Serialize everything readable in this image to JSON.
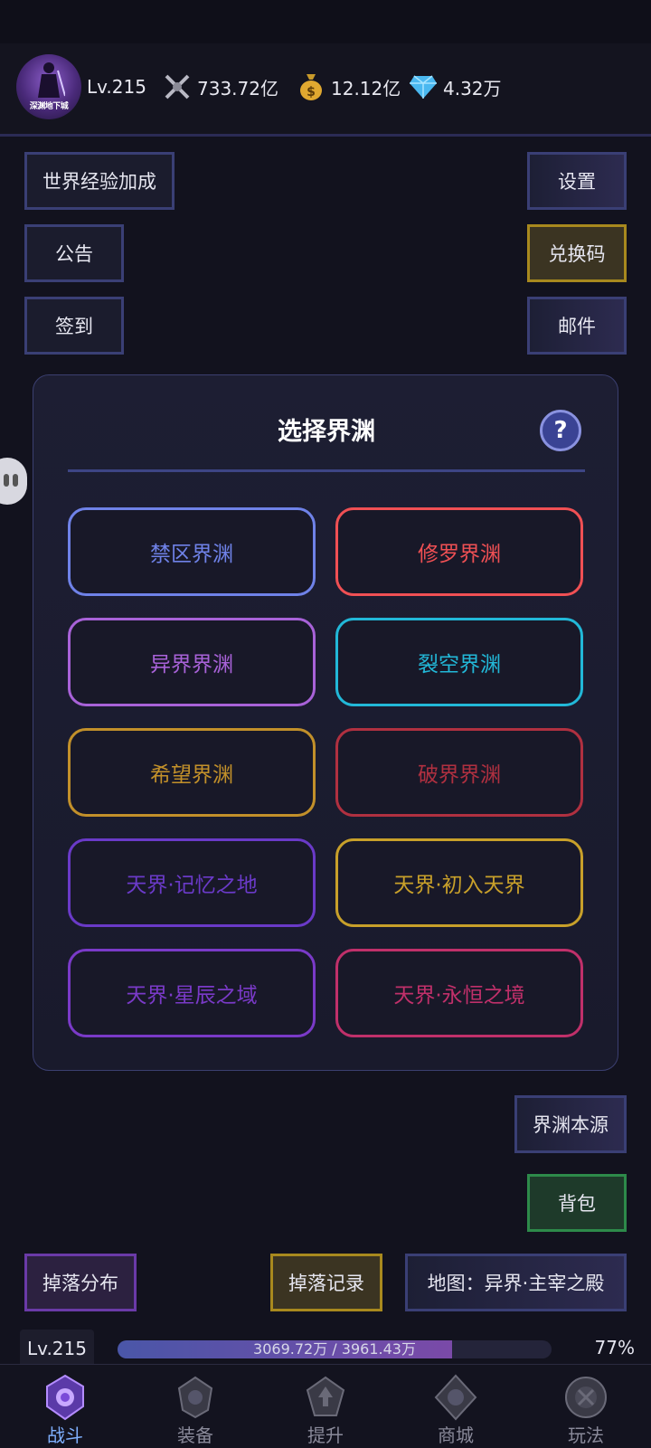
{
  "header": {
    "level": "Lv.215",
    "avatar_logo": "深渊地下城",
    "stats": [
      {
        "icon": "swords-icon",
        "value": "733.72亿"
      },
      {
        "icon": "money-bag-icon",
        "value": "12.12亿"
      },
      {
        "icon": "diamond-icon",
        "value": "4.32万"
      }
    ]
  },
  "left_buttons": {
    "world_exp": "世界经验加成",
    "notice": "公告",
    "sign_in": "签到"
  },
  "right_buttons": {
    "settings": "设置",
    "redeem": "兑换码",
    "mail": "邮件"
  },
  "panel": {
    "title": "选择界渊",
    "help": "?",
    "abysses": [
      {
        "label": "禁区界渊",
        "color": "#6f82e8"
      },
      {
        "label": "修罗界渊",
        "color": "#f05054"
      },
      {
        "label": "异界界渊",
        "color": "#a862d8"
      },
      {
        "label": "裂空界渊",
        "color": "#22b8d8"
      },
      {
        "label": "希望界渊",
        "color": "#c2902a"
      },
      {
        "label": "破界界渊",
        "color": "#b03040"
      },
      {
        "label": "天界·记忆之地",
        "color": "#6a3ac8"
      },
      {
        "label": "天界·初入天界",
        "color": "#c8a02a"
      },
      {
        "label": "天界·星辰之域",
        "color": "#7a3ac8"
      },
      {
        "label": "天界·永恒之境",
        "color": "#c0306a"
      }
    ]
  },
  "side_buttons": {
    "abyss_source": "界渊本源",
    "backpack": "背包"
  },
  "bottom_buttons": {
    "drop_distribution": "掉落分布",
    "drop_record": "掉落记录",
    "map": "地图：异界·主宰之殿"
  },
  "exp": {
    "level": "Lv.215",
    "text": "3069.72万 / 3961.43万",
    "percent": "77%",
    "fraction": 0.77
  },
  "nav": [
    {
      "label": "战斗",
      "active": true
    },
    {
      "label": "装备",
      "active": false
    },
    {
      "label": "提升",
      "active": false
    },
    {
      "label": "商城",
      "active": false
    },
    {
      "label": "玩法",
      "active": false
    }
  ]
}
